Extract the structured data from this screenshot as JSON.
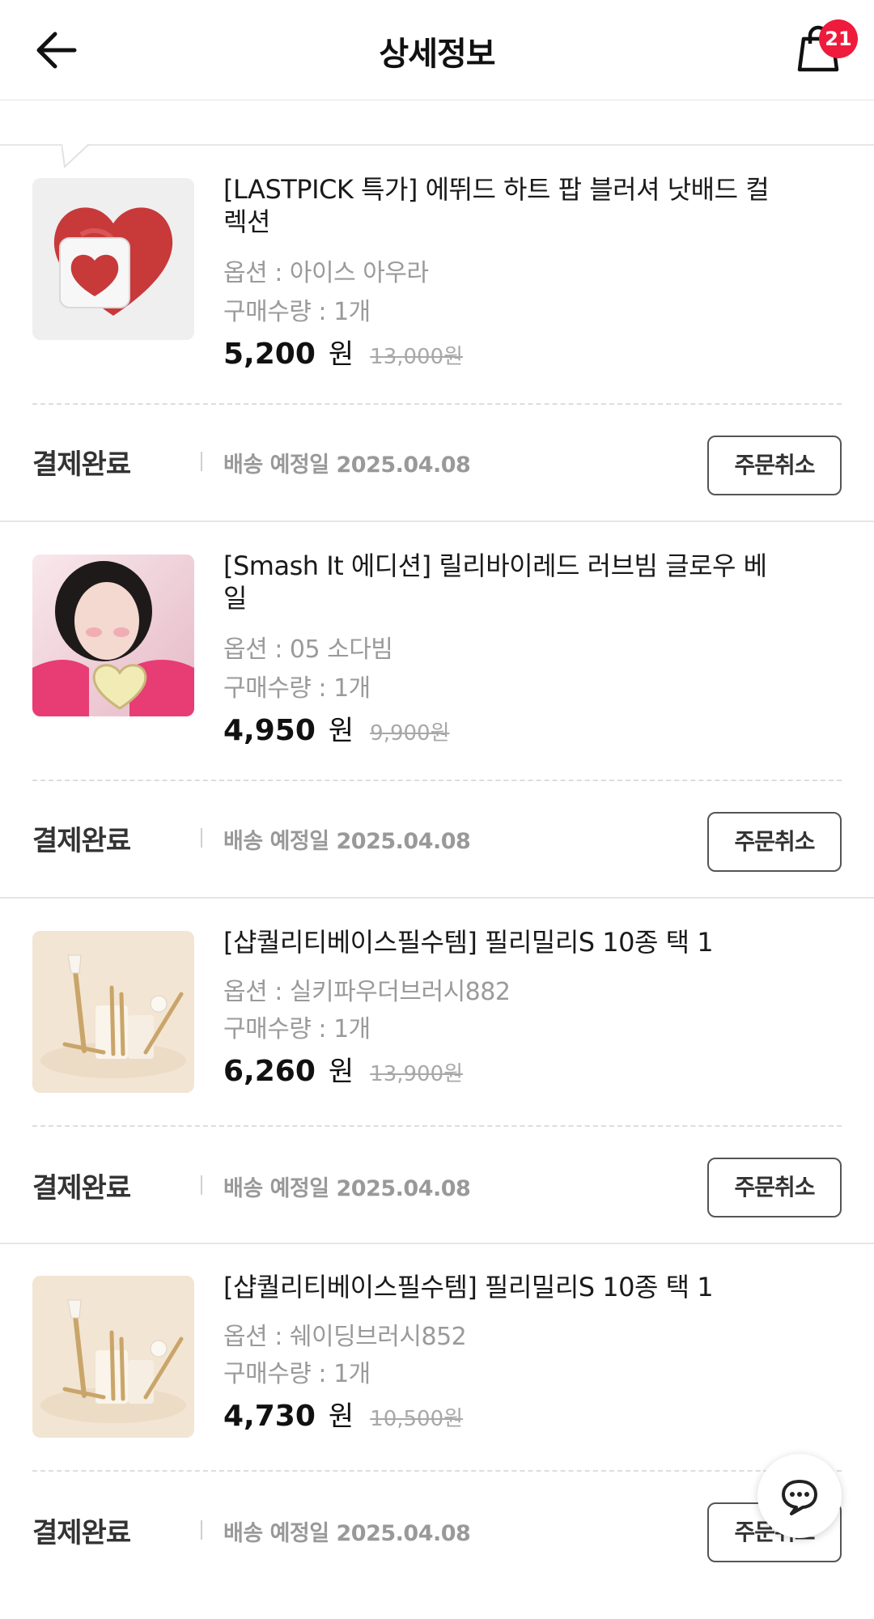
{
  "header": {
    "title": "상세정보",
    "cart_count": "21"
  },
  "orders": [
    {
      "name": "[LASTPICK 특가] 에뛰드 하트 팝 블러셔 낫배드 컬렉션",
      "option": "옵션 : 아이스 아우라",
      "quantity": "구매수량 : 1개",
      "price": "5,200",
      "unit": "원",
      "original_price": "13,000원",
      "status": "결제완료",
      "delivery": "배송 예정일 2025.04.08",
      "cancel_label": "주문취소",
      "image": "heart-blusher-red"
    },
    {
      "name": "[Smash It 에디션] 릴리바이레드 러브빔 글로우 베일",
      "option": "옵션 : 05 소다빔",
      "quantity": "구매수량 : 1개",
      "price": "4,950",
      "unit": "원",
      "original_price": "9,900원",
      "status": "결제완료",
      "delivery": "배송 예정일 2025.04.08",
      "cancel_label": "주문취소",
      "image": "model-with-heart-compact"
    },
    {
      "name": "[샵퀄리티베이스필수템] 필리밀리S 10종 택 1",
      "option": "옵션 : 실키파우더브러시882",
      "quantity": "구매수량 : 1개",
      "price": "6,260",
      "unit": "원",
      "original_price": "13,900원",
      "status": "결제완료",
      "delivery": "배송 예정일 2025.04.08",
      "cancel_label": "주문취소",
      "image": "makeup-brushes"
    },
    {
      "name": "[샵퀄리티베이스필수템] 필리밀리S 10종 택 1",
      "option": "옵션 : 쉐이딩브러시852",
      "quantity": "구매수량 : 1개",
      "price": "4,730",
      "unit": "원",
      "original_price": "10,500원",
      "status": "결제완료",
      "delivery": "배송 예정일 2025.04.08",
      "cancel_label": "주문취소",
      "image": "makeup-brushes"
    }
  ]
}
